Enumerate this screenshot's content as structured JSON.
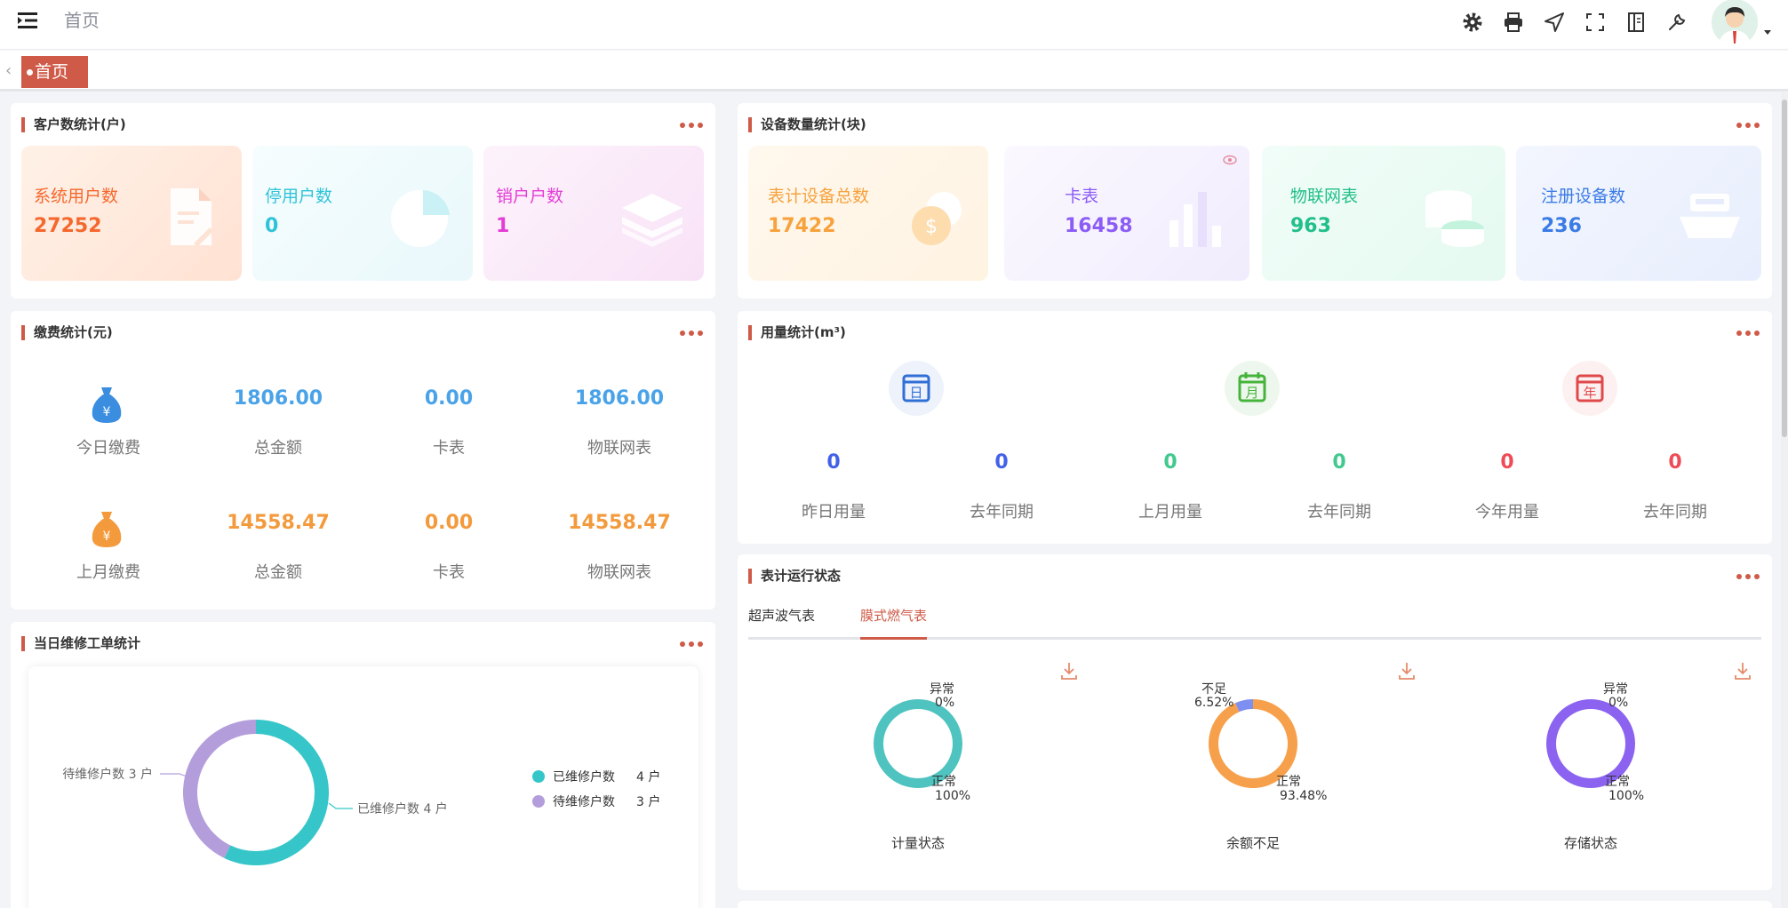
{
  "header": {
    "breadcrumb": "首页"
  },
  "tabs": {
    "home": "首页"
  },
  "customer": {
    "title": "客户数统计(户)",
    "cards": [
      {
        "label": "系统用户数",
        "value": "27252",
        "color": "#f5682d"
      },
      {
        "label": "停用户数",
        "value": "0",
        "color": "#2fc3d8"
      },
      {
        "label": "销户户数",
        "value": "1",
        "color": "#e43dd6"
      }
    ]
  },
  "device": {
    "title": "设备数量统计(块)",
    "cards": [
      {
        "label": "表计设备总数",
        "value": "17422",
        "color": "#f7a23c"
      },
      {
        "label": "卡表",
        "value": "16458",
        "color": "#8b5cf6"
      },
      {
        "label": "物联网表",
        "value": "963",
        "color": "#22bf8a"
      },
      {
        "label": "注册设备数",
        "value": "236",
        "color": "#3a7be6"
      }
    ]
  },
  "fee": {
    "title": "缴费统计(元)",
    "today": {
      "label": "今日缴费",
      "total": "1806.00",
      "total_label": "总金额",
      "card": "0.00",
      "card_label": "卡表",
      "iot": "1806.00",
      "iot_label": "物联网表"
    },
    "last_month": {
      "label": "上月缴费",
      "total": "14558.47",
      "total_label": "总金额",
      "card": "0.00",
      "card_label": "卡表",
      "iot": "14558.47",
      "iot_label": "物联网表"
    }
  },
  "usage": {
    "title": "用量统计(m³)",
    "icons": [
      "日",
      "月",
      "年"
    ],
    "items": [
      {
        "value": "0",
        "label": "昨日用量"
      },
      {
        "value": "0",
        "label": "去年同期"
      },
      {
        "value": "0",
        "label": "上月用量"
      },
      {
        "value": "0",
        "label": "去年同期"
      },
      {
        "value": "0",
        "label": "今年用量"
      },
      {
        "value": "0",
        "label": "去年同期"
      }
    ]
  },
  "repair": {
    "title": "当日维修工单统计",
    "left_label": "待维修户数  3  户",
    "right_label": "已维修户数  4  户",
    "legend": [
      {
        "name": "已维修户数",
        "count": "4 户",
        "color": "#36c6c9"
      },
      {
        "name": "待维修户数",
        "count": "3 户",
        "color": "#b39ddb"
      }
    ]
  },
  "meter": {
    "title": "表计运行状态",
    "tabs": [
      "超声波气表",
      "膜式燃气表"
    ],
    "gauges": [
      {
        "name": "计量状态",
        "top_label": "异常",
        "top_pct": "0%",
        "bottom_label": "正常",
        "bottom_pct": "100%"
      },
      {
        "name": "余额不足",
        "top_label": "不足",
        "top_pct": "6.52%",
        "bottom_label": "正常",
        "bottom_pct": "93.48%"
      },
      {
        "name": "存储状态",
        "top_label": "异常",
        "top_pct": "0%",
        "bottom_label": "正常",
        "bottom_pct": "100%"
      }
    ]
  },
  "chart_data": [
    {
      "type": "pie",
      "categories": [
        "已维修户数",
        "待维修户数"
      ],
      "values": [
        4,
        3
      ],
      "colors": [
        "#36c6c9",
        "#b39ddb"
      ],
      "legend": "right"
    },
    {
      "type": "pie",
      "title": "计量状态",
      "categories": [
        "正常",
        "异常"
      ],
      "values": [
        100,
        0
      ],
      "colors": [
        "#4fc3bf",
        "#f0a070"
      ]
    },
    {
      "type": "pie",
      "title": "余额不足",
      "categories": [
        "正常",
        "不足"
      ],
      "values": [
        93.48,
        6.52
      ],
      "colors": [
        "#f7a04b",
        "#7d8ff0"
      ]
    },
    {
      "type": "pie",
      "title": "存储状态",
      "categories": [
        "正常",
        "异常"
      ],
      "values": [
        100,
        0
      ],
      "colors": [
        "#8b63f0",
        "#f0a070"
      ]
    }
  ]
}
